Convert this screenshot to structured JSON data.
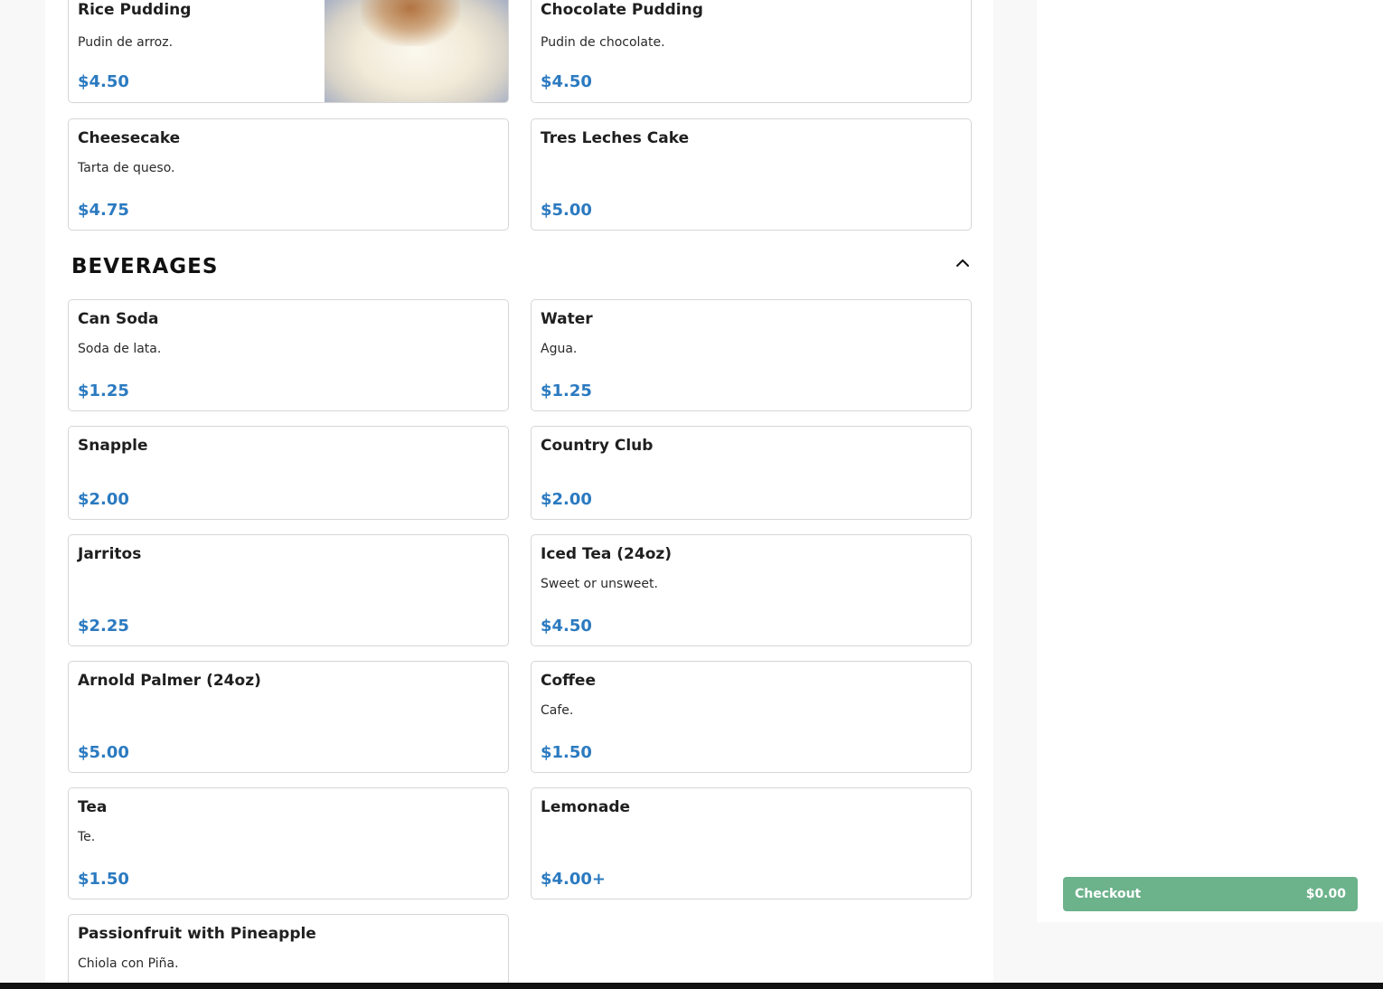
{
  "sections": {
    "beverages_title": "BEVERAGES",
    "collapse_icon": "chevron-up-icon"
  },
  "desserts": [
    {
      "name": "Rice Pudding",
      "desc": "Pudin de arroz.",
      "price": "$4.50",
      "has_photo": true
    },
    {
      "name": "Chocolate Pudding",
      "desc": "Pudin de chocolate.",
      "price": "$4.50"
    },
    {
      "name": "Cheesecake",
      "desc": "Tarta de queso.",
      "price": "$4.75"
    },
    {
      "name": "Tres Leches Cake",
      "desc": "",
      "price": "$5.00"
    }
  ],
  "beverages": [
    {
      "name": "Can Soda",
      "desc": "Soda de lata.",
      "price": "$1.25"
    },
    {
      "name": "Water",
      "desc": "Agua.",
      "price": "$1.25"
    },
    {
      "name": "Snapple",
      "desc": "",
      "price": "$2.00"
    },
    {
      "name": "Country Club",
      "desc": "",
      "price": "$2.00"
    },
    {
      "name": "Jarritos",
      "desc": "",
      "price": "$2.25"
    },
    {
      "name": "Iced Tea (24oz)",
      "desc": "Sweet or unsweet.",
      "price": "$4.50"
    },
    {
      "name": "Arnold Palmer (24oz)",
      "desc": "",
      "price": "$5.00"
    },
    {
      "name": "Coffee",
      "desc": "Cafe.",
      "price": "$1.50"
    },
    {
      "name": "Tea",
      "desc": "Te.",
      "price": "$1.50"
    },
    {
      "name": "Lemonade",
      "desc": "",
      "price": "$4.00+"
    },
    {
      "name": "Passionfruit with Pineapple",
      "desc": "Chiola con Piña.",
      "price": ""
    }
  ],
  "checkout": {
    "label": "Checkout",
    "total": "$0.00"
  },
  "colors": {
    "price": "#2b7ac0",
    "checkout_bg": "#6cb28b"
  }
}
